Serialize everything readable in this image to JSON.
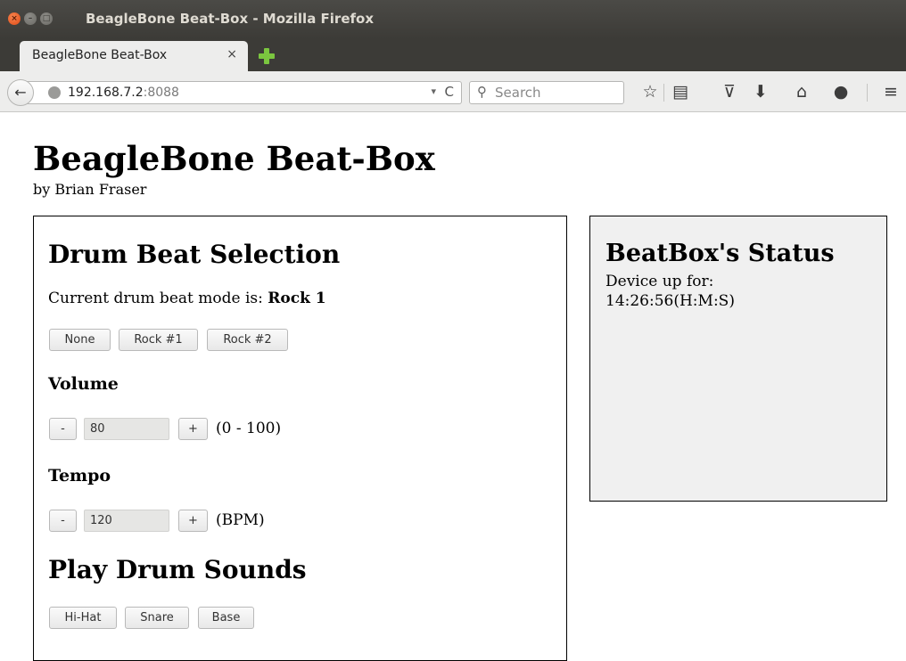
{
  "window": {
    "title": "BeagleBone Beat-Box - Mozilla Firefox",
    "close_glyph": "×",
    "min_glyph": "–",
    "max_glyph": "□"
  },
  "tab": {
    "label": "BeagleBone Beat-Box",
    "close_glyph": "×"
  },
  "navbar": {
    "back_glyph": "←",
    "url_host": "192.168.7.2",
    "url_port": ":8088",
    "dropdown_glyph": "▾",
    "reload_glyph": "C",
    "search_glyph": "⚲",
    "search_placeholder": "Search",
    "icons": {
      "bookmark": "☆",
      "reading_list": "▤",
      "pocket": "⊽",
      "download": "⬇",
      "home": "⌂",
      "chat": "●",
      "menu": "≡"
    }
  },
  "page": {
    "title": "BeagleBone Beat-Box",
    "byline": "by Brian Fraser"
  },
  "drum_panel": {
    "heading": "Drum Beat Selection",
    "mode_prefix": "Current drum beat mode is: ",
    "mode_value": "Rock 1",
    "mode_buttons": [
      "None",
      "Rock #1",
      "Rock #2"
    ],
    "volume_heading": "Volume",
    "volume_minus": "-",
    "volume_value": "80",
    "volume_plus": "+",
    "volume_range": "(0 - 100)",
    "tempo_heading": "Tempo",
    "tempo_minus": "-",
    "tempo_value": "120",
    "tempo_plus": "+",
    "tempo_unit": "(BPM)",
    "sounds_heading": "Play Drum Sounds",
    "sound_buttons": [
      "Hi-Hat",
      "Snare",
      "Base"
    ]
  },
  "status_panel": {
    "heading": "BeatBox's Status",
    "uptime_label": "Device up for:",
    "uptime_value": "14:26:56(H:M:S)"
  },
  "colors": {
    "titlebar": "#3c3b37",
    "toolbar": "#ededec",
    "status_panel_bg": "#f0f0f0",
    "close_button": "#df4a16",
    "new_tab_green": "#7bc63f"
  }
}
